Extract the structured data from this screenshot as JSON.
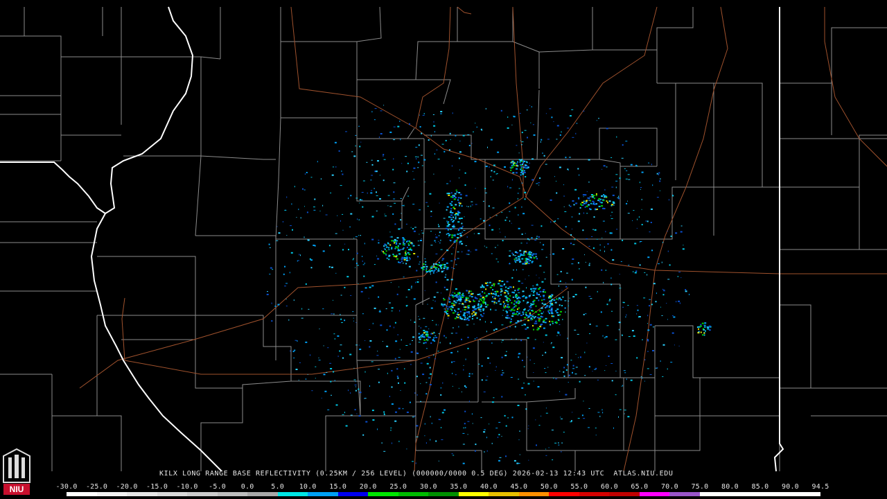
{
  "product_title": "KILX LONG RANGE BASE REFLECTIVITY (0.25KM / 256 LEVEL) (000000/0000 0.5 DEG) 2026-02-13 12:43 UTC  ATLAS.NIU.EDU",
  "logo": {
    "text": "NIU",
    "color": "#c8102e"
  },
  "legend": {
    "labels": [
      "-30.0",
      "-25.0",
      "-20.0",
      "-15.0",
      "-10.0",
      "-5.0",
      "0.0",
      "5.0",
      "10.0",
      "15.0",
      "20.0",
      "25.0",
      "30.0",
      "35.0",
      "40.0",
      "45.0",
      "50.0",
      "55.0",
      "60.0",
      "65.0",
      "70.0",
      "75.0",
      "80.0",
      "85.0",
      "90.0",
      "94.5"
    ],
    "colors": [
      "#ffffff",
      "#f2f2f2",
      "#e6e6e6",
      "#d9d9d9",
      "#cccccc",
      "#bdbdbd",
      "#a8a8a8",
      "#00e6e6",
      "#00a0f5",
      "#0000f0",
      "#00e600",
      "#00bb00",
      "#009000",
      "#ffff00",
      "#e7c000",
      "#ff9000",
      "#ff0000",
      "#d60000",
      "#c00000",
      "#ff00ff",
      "#9955c9",
      "#ffffff",
      "#ffffff",
      "#ffffff",
      "#ffffff"
    ]
  },
  "map_colors": {
    "background": "#000000",
    "county_lines": "#9a9a9a",
    "state_lines": "#ffffff",
    "highways": "#a0522d"
  }
}
